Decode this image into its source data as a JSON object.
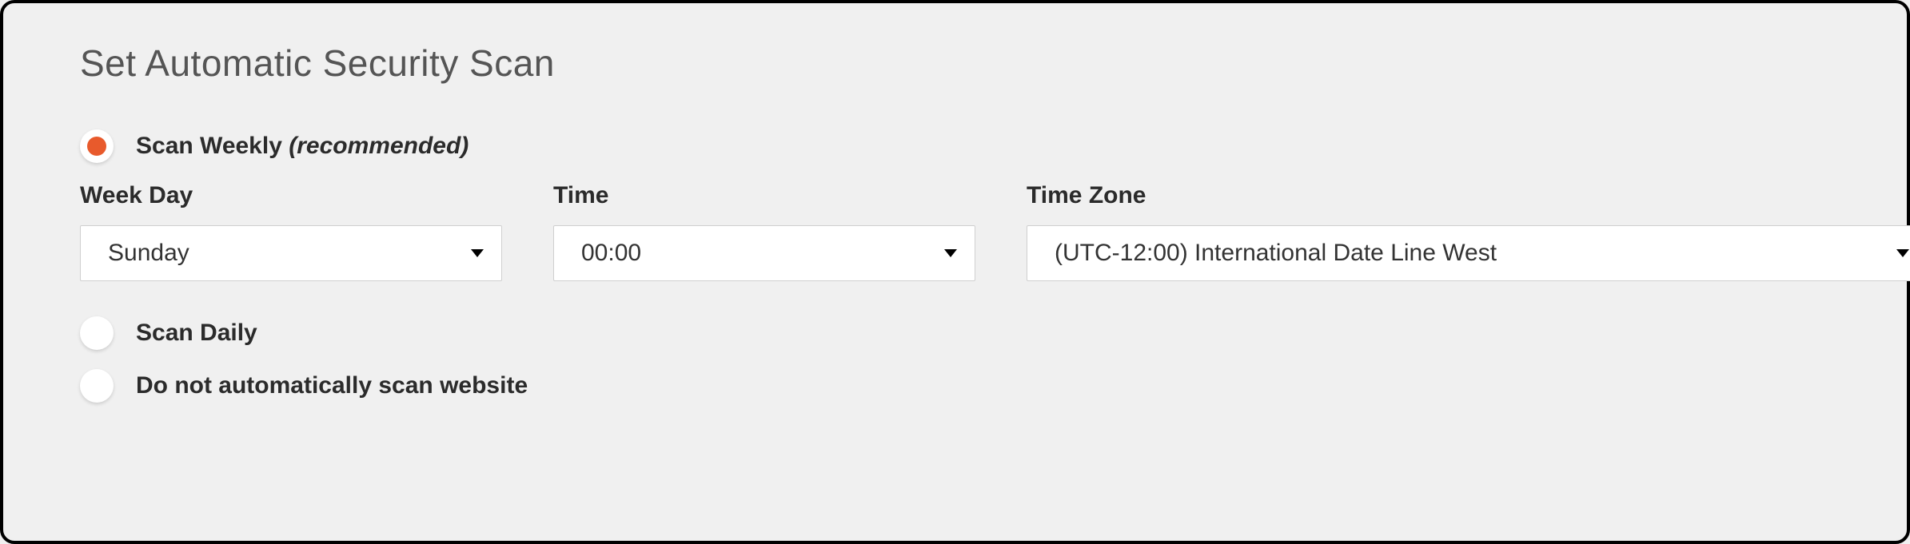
{
  "title": "Set Automatic Security Scan",
  "options": {
    "weekly": {
      "label": "Scan Weekly ",
      "recommended": "(recommended)",
      "selected": true
    },
    "daily": {
      "label": "Scan Daily",
      "selected": false
    },
    "none": {
      "label": "Do not automatically scan website",
      "selected": false
    }
  },
  "fields": {
    "weekday": {
      "label": "Week Day",
      "value": "Sunday"
    },
    "time": {
      "label": "Time",
      "value": "00:00"
    },
    "timezone": {
      "label": "Time Zone",
      "value": "(UTC-12:00) International Date Line West"
    }
  },
  "colors": {
    "accent": "#e85a2c"
  }
}
